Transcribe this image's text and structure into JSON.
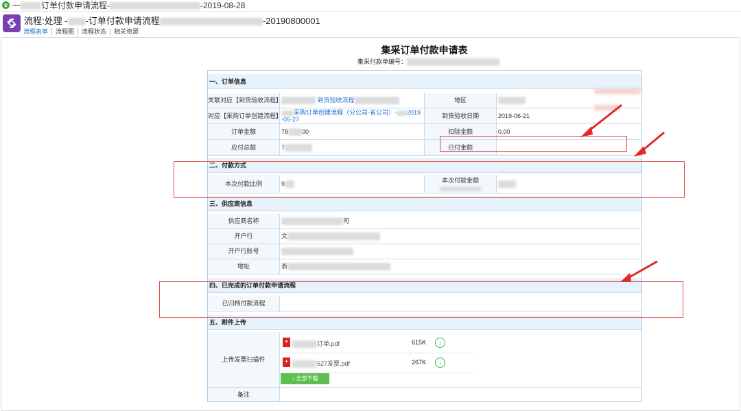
{
  "window": {
    "title_prefix": "一",
    "title_mid": "订单付款申请流程-",
    "title_date": "-2019-08-28"
  },
  "process": {
    "title_prefix": "流程:处理 -",
    "title_mid": "-订单付款申请流程",
    "title_suffix": "-20190800001",
    "tabs": [
      "流程表单",
      "流程图",
      "流程状态",
      "相关资源"
    ]
  },
  "form": {
    "title": "集采订单付款申请表",
    "number_label": "集采付款单编号：",
    "sections": {
      "order": "一、订单信息",
      "payment": "二、付款方式",
      "supplier": "三、供应商信息",
      "completed": "四、已完成的订单付款申请流程",
      "attach": "五、附件上传"
    },
    "order": {
      "related_receipt_label": "关联对应【到货验收流程】",
      "related_receipt_value": "到货验收流程",
      "region_label": "地区",
      "related_po_label": "对应【采购订单创建流程】",
      "related_po_value_1": "采购订单创建流程（分公司-省公司）-",
      "related_po_value_year": "2019",
      "related_po_value_2": "-05-27",
      "receipt_date_label": "到货验收日期",
      "receipt_date_value": "2019-06-21",
      "order_amount_label": "订单金额",
      "order_amount_start": "78",
      "order_amount_end": "00",
      "deduction_label": "扣除金额",
      "deduction_value": "0.00",
      "payable_label": "应付总额",
      "payable_start": "7",
      "paid_label": "已付金额"
    },
    "payment": {
      "ratio_label": "本次付款比例",
      "ratio_value": "9",
      "amount_label": "本次付款金额"
    },
    "supplier": {
      "name_label": "供应商名称",
      "name_end": "司",
      "bank_label": "开户行",
      "bank_start": "文",
      "account_label": "开户行账号",
      "address_label": "地址",
      "address_start": "浙"
    },
    "completed": {
      "archived_label": "已归档付款流程"
    },
    "attach": {
      "upload_label": "上传发票扫描件",
      "files": [
        {
          "name": "订单.pdf",
          "size": "615K"
        },
        {
          "name": "527发票.pdf",
          "size": "267K"
        }
      ],
      "download_all": "全部下载"
    },
    "remark_label": "备注"
  }
}
